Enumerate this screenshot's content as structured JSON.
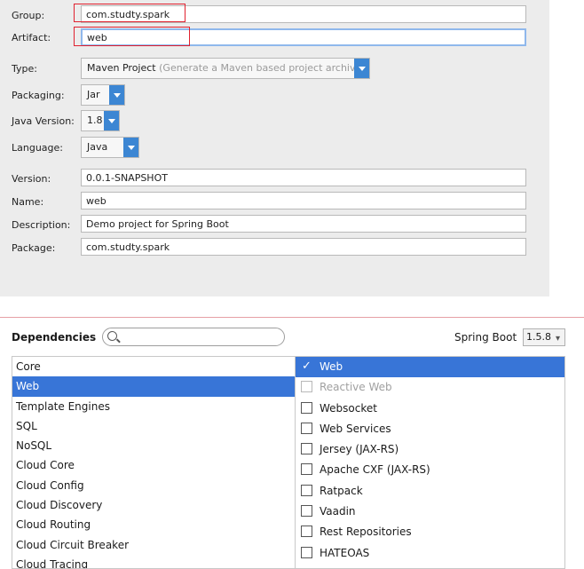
{
  "project": {
    "group_label": "Group:",
    "group_value": "com.studty.spark",
    "artifact_label": "Artifact:",
    "artifact_value": "web",
    "type_label": "Type:",
    "type_value": "Maven Project",
    "type_hint": "(Generate a Maven based project archive)",
    "packaging_label": "Packaging:",
    "packaging_value": "Jar",
    "java_version_label": "Java Version:",
    "java_version_value": "1.8",
    "language_label": "Language:",
    "language_value": "Java",
    "version_label": "Version:",
    "version_value": "0.0.1-SNAPSHOT",
    "name_label": "Name:",
    "name_value": "web",
    "description_label": "Description:",
    "description_value": "Demo project for Spring Boot",
    "package_label": "Package:",
    "package_value": "com.studty.spark"
  },
  "dependencies": {
    "title": "Dependencies",
    "search_placeholder": "",
    "spring_boot_label": "Spring Boot",
    "spring_boot_version": "1.5.8",
    "categories": [
      "Core",
      "Web",
      "Template Engines",
      "SQL",
      "NoSQL",
      "Cloud Core",
      "Cloud Config",
      "Cloud Discovery",
      "Cloud Routing",
      "Cloud Circuit Breaker",
      "Cloud Tracing"
    ],
    "selected_category": "Web",
    "items": [
      {
        "label": "Web",
        "checked": true,
        "disabled": false
      },
      {
        "label": "Reactive Web",
        "checked": false,
        "disabled": true
      },
      {
        "label": "Websocket",
        "checked": false,
        "disabled": false
      },
      {
        "label": "Web Services",
        "checked": false,
        "disabled": false
      },
      {
        "label": "Jersey (JAX-RS)",
        "checked": false,
        "disabled": false
      },
      {
        "label": "Apache CXF (JAX-RS)",
        "checked": false,
        "disabled": false
      },
      {
        "label": "Ratpack",
        "checked": false,
        "disabled": false
      },
      {
        "label": "Vaadin",
        "checked": false,
        "disabled": false
      },
      {
        "label": "Rest Repositories",
        "checked": false,
        "disabled": false
      },
      {
        "label": "HATEOAS",
        "checked": false,
        "disabled": false
      }
    ]
  },
  "colors": {
    "selection": "#3875d7",
    "highlight_box": "#e0212f",
    "combo_arrow": "#3c86d3"
  }
}
